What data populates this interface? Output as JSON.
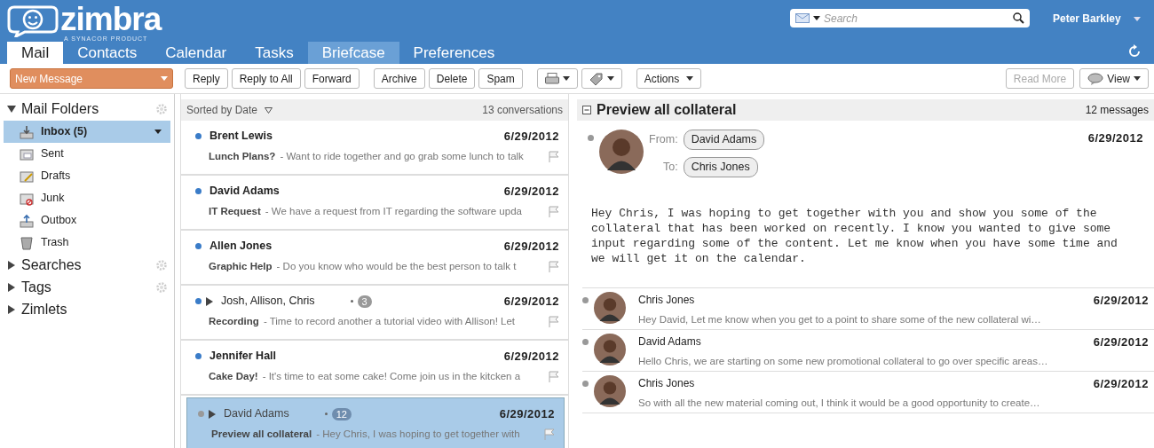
{
  "logo": {
    "name": "zimbra",
    "tagline": "A SYNACOR PRODUCT"
  },
  "search": {
    "placeholder": "Search"
  },
  "user": {
    "name": "Peter Barkley"
  },
  "tabs": [
    {
      "label": "Mail",
      "selected": true,
      "hovered": false
    },
    {
      "label": "Contacts",
      "selected": false,
      "hovered": false
    },
    {
      "label": "Calendar",
      "selected": false,
      "hovered": false
    },
    {
      "label": "Tasks",
      "selected": false,
      "hovered": false
    },
    {
      "label": "Briefcase",
      "selected": false,
      "hovered": true
    },
    {
      "label": "Preferences",
      "selected": false,
      "hovered": false
    }
  ],
  "toolbar": {
    "new_message": "New Message",
    "buttons": [
      {
        "kind": "text",
        "label": "Reply",
        "disabled": false
      },
      {
        "kind": "text",
        "label": "Reply to All",
        "disabled": false
      },
      {
        "kind": "text",
        "label": "Forward",
        "disabled": false
      },
      {
        "kind": "text",
        "label": "Archive",
        "disabled": false
      },
      {
        "kind": "text",
        "label": "Delete",
        "disabled": false
      },
      {
        "kind": "text",
        "label": "Spam",
        "disabled": false
      },
      {
        "kind": "print",
        "disabled": false
      },
      {
        "kind": "tag",
        "disabled": false
      },
      {
        "kind": "menu",
        "label": "Actions",
        "disabled": false
      }
    ],
    "right_buttons": [
      {
        "kind": "text",
        "label": "Read More",
        "disabled": true
      },
      {
        "kind": "view",
        "label": "View",
        "disabled": false
      }
    ]
  },
  "sidebar": {
    "sections": [
      {
        "label": "Mail Folders",
        "expanded": true,
        "gear": true,
        "items": [
          {
            "label": "Inbox (5)",
            "kind": "inbox",
            "selected": true
          },
          {
            "label": "Sent",
            "kind": "sent",
            "selected": false
          },
          {
            "label": "Drafts",
            "kind": "drafts",
            "selected": false
          },
          {
            "label": "Junk",
            "kind": "junk",
            "selected": false
          },
          {
            "label": "Outbox",
            "kind": "outbox",
            "selected": false
          },
          {
            "label": "Trash",
            "kind": "trash",
            "selected": false
          }
        ]
      },
      {
        "label": "Searches",
        "expanded": false,
        "gear": true
      },
      {
        "label": "Tags",
        "expanded": false,
        "gear": true
      },
      {
        "label": "Zimlets",
        "expanded": false,
        "gear": false
      }
    ]
  },
  "message_list": {
    "sort": "Sorted by Date",
    "count": "13 conversations",
    "items": [
      {
        "sender": "Brent Lewis",
        "date": "6/29/2012",
        "subject": "Lunch Plans?",
        "snippet": "- Want to ride together and go grab some lunch to talk",
        "unread": true,
        "selected": false
      },
      {
        "sender": "David Adams",
        "date": "6/29/2012",
        "subject": "IT Request",
        "snippet": "- We have a request from IT regarding the software upda",
        "unread": true,
        "selected": false
      },
      {
        "sender": "Allen Jones",
        "date": "6/29/2012",
        "subject": "Graphic Help",
        "snippet": "- Do you know who would be the best person to talk t",
        "unread": true,
        "selected": false
      },
      {
        "sender": "Josh, Allison, Chris",
        "date": "6/29/2012",
        "subject": "Recording",
        "snippet": "- Time to record another a tutorial video with Allison! Let",
        "unread": true,
        "selected": false,
        "thread_count": "3"
      },
      {
        "sender": "Jennifer Hall",
        "date": "6/29/2012",
        "subject": "Cake Day!",
        "snippet": "- It's time to eat some cake! Come join us in the kitcken a",
        "unread": true,
        "selected": false
      },
      {
        "sender": "David Adams",
        "date": "6/29/2012",
        "subject": "Preview all collateral",
        "snippet": "- Hey Chris, I was hoping to get together with",
        "unread": false,
        "selected": true,
        "thread_count": "12"
      }
    ]
  },
  "reading_pane": {
    "title": "Preview all collateral",
    "count": "12 messages",
    "message": {
      "from_label": "From:",
      "from": "David Adams",
      "to_label": "To:",
      "to": "Chris Jones",
      "date": "6/29/2012",
      "body": "Hey Chris, I was hoping to get together with you and show you some of the collateral that has been worked on recently. I know you wanted to give some input regarding some of the content. Let me know when you have some time and we will get it on the calendar."
    },
    "thread": [
      {
        "sender": "Chris Jones",
        "date": "6/29/2012",
        "snippet": "Hey David, Let me know when you get to a point to share some of the new collateral wi…"
      },
      {
        "sender": "David Adams",
        "date": "6/29/2012",
        "snippet": "Hello Chris, we are starting on some new promotional collateral to go over specific areas…"
      },
      {
        "sender": "Chris Jones",
        "date": "6/29/2012",
        "snippet": "So with all the new material coming out, I think it would be a good opportunity to create…"
      }
    ]
  }
}
